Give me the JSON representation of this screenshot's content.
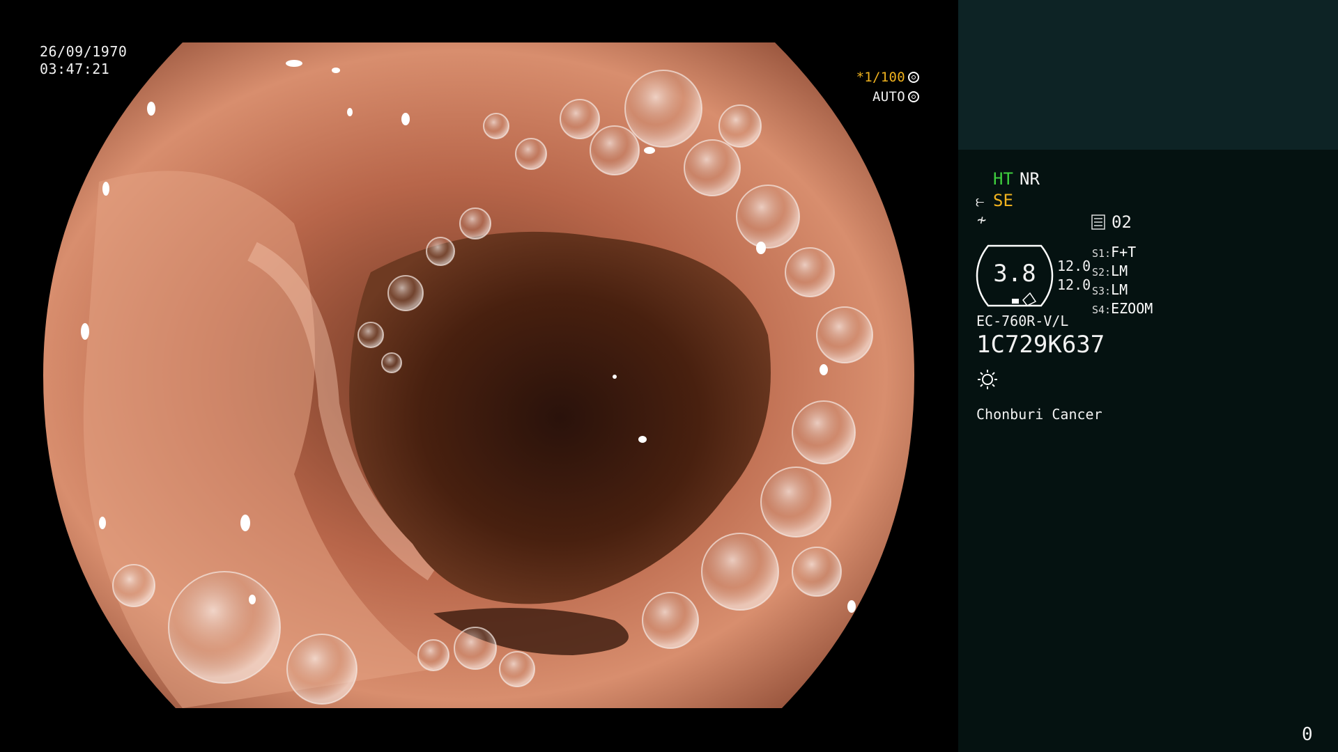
{
  "overlay": {
    "date": "26/09/1970",
    "time": "03:47:21",
    "shutter_value": "*1/100",
    "exposure_mode": "AUTO",
    "shutter_icon": "aperture-icon",
    "exposure_icon": "iris-icon"
  },
  "panel": {
    "ht_label": "HT",
    "nr_label": "NR",
    "se_label": "SE",
    "se_icon": "structure-enhance-icon",
    "mode_icon": "color-mode-icon",
    "count_icon": "frame-counter-icon",
    "count_value": "02",
    "gauge_value": "3.8",
    "left_value_1": "12.0",
    "left_value_2": "12.0",
    "switches": [
      {
        "label": "S1:",
        "value": "F+T"
      },
      {
        "label": "S2:",
        "value": "LM"
      },
      {
        "label": "S3:",
        "value": "LM"
      },
      {
        "label": "S4:",
        "value": "EZOOM"
      }
    ],
    "scope_model": "EC-760R-V/L",
    "serial": "1C729K637",
    "light_icon": "sun-icon",
    "institution": "Chonburi Cancer",
    "page_number": "0"
  },
  "colors": {
    "ht": "#3ecf3e",
    "se": "#f0b21e",
    "shutter": "#f0b21e",
    "panel_top": "#0d2325",
    "panel_bottom": "#051211"
  }
}
